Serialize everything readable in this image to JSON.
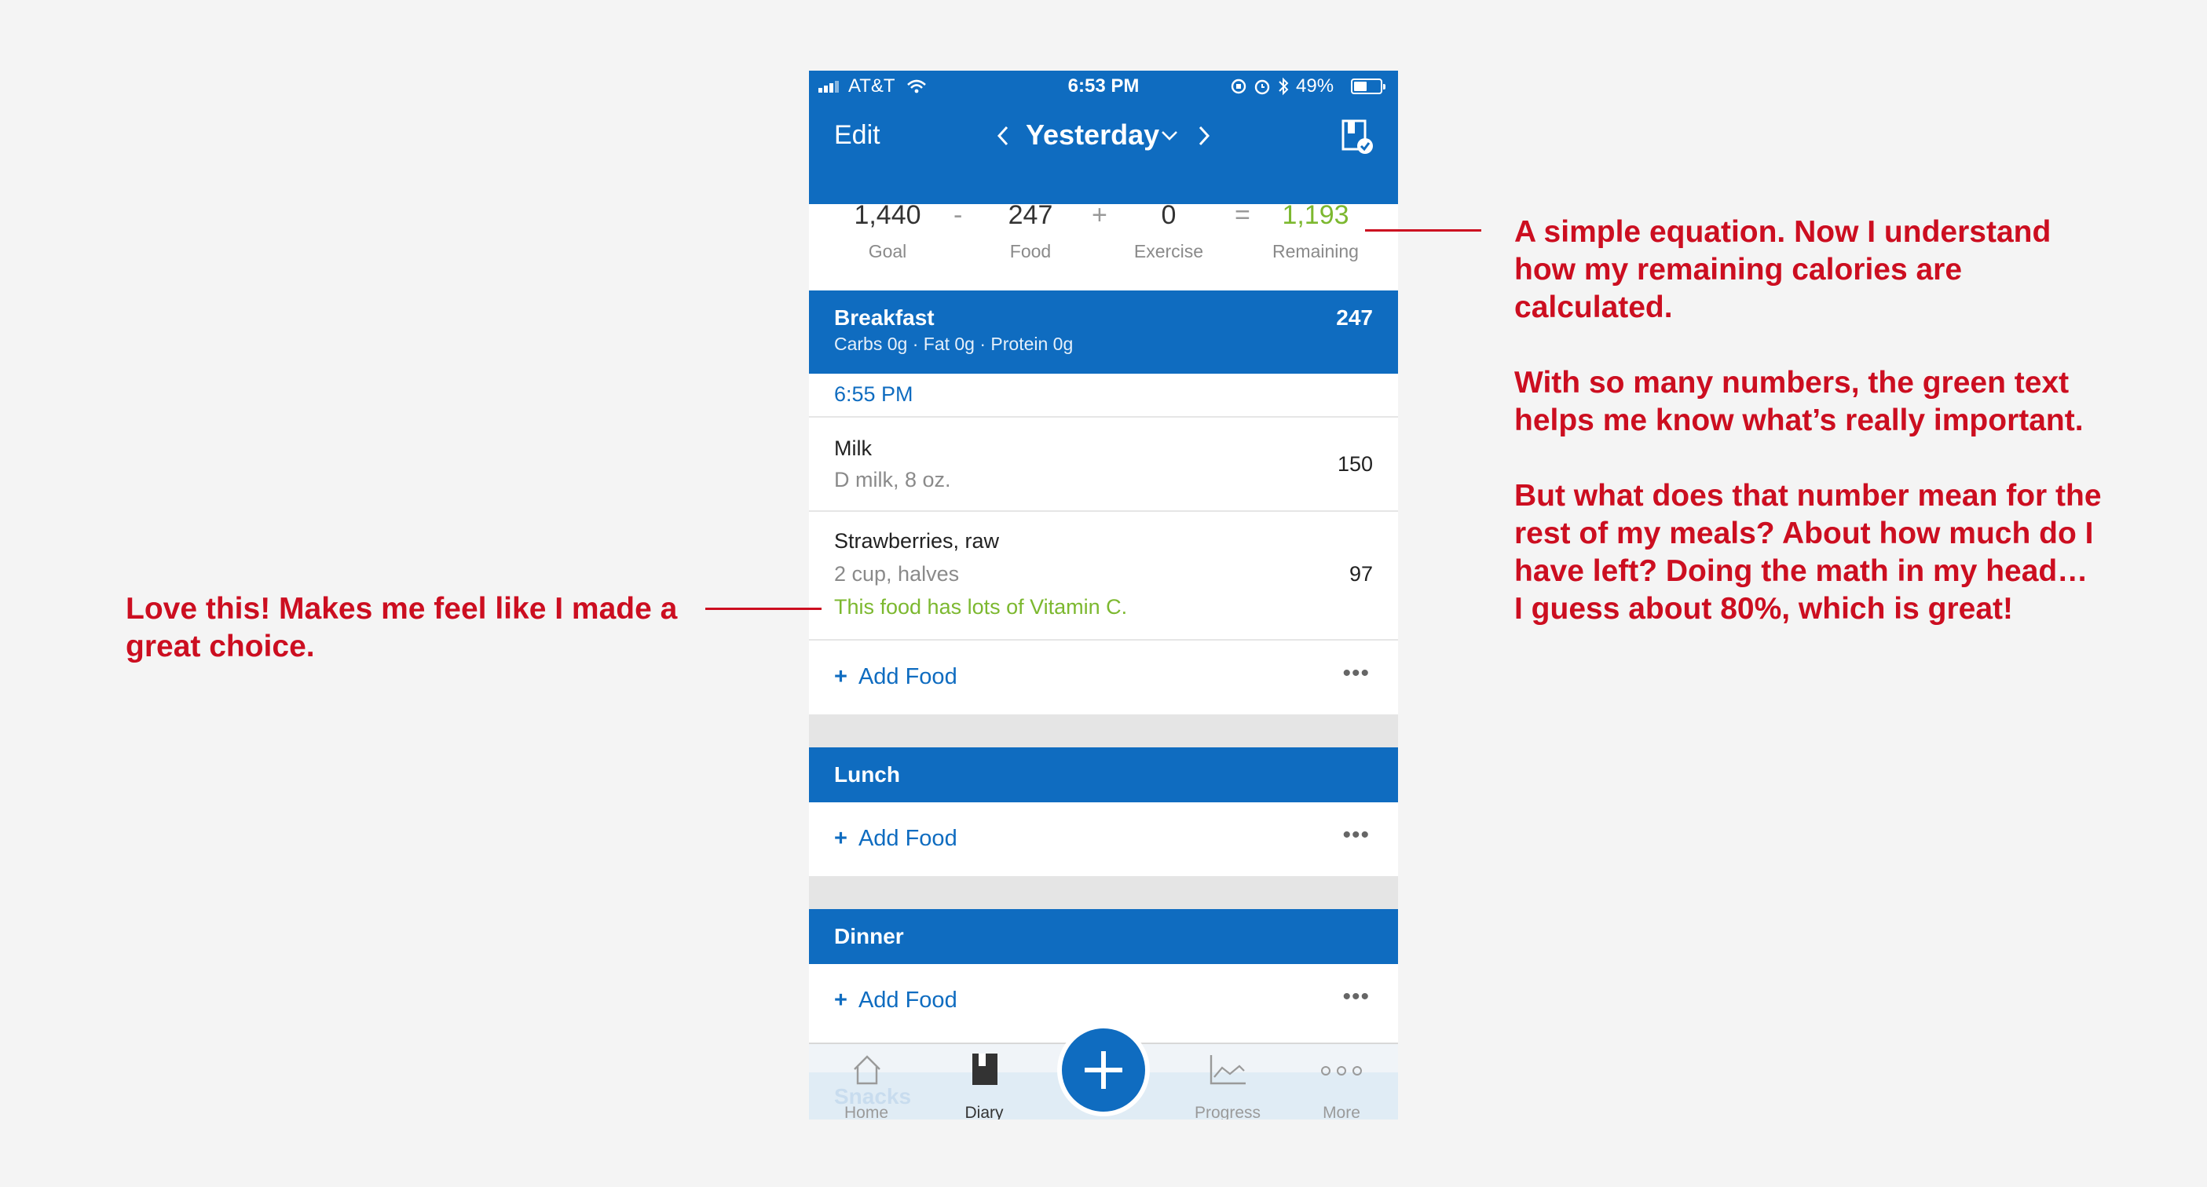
{
  "status_bar": {
    "carrier": "AT&T",
    "time": "6:53 PM",
    "battery": "49%",
    "battery_level": 0.49
  },
  "nav": {
    "edit_label": "Edit",
    "title": "Yesterday",
    "prev_icon": "chevron-left-icon",
    "next_icon": "chevron-right-icon",
    "dropdown_icon": "chevron-down-icon",
    "action_icon": "diary-check-icon"
  },
  "summary": {
    "goal_value": "1,440",
    "goal_label": "Goal",
    "op_minus": "-",
    "food_value": "247",
    "food_label": "Food",
    "op_plus": "+",
    "exercise_value": "0",
    "exercise_label": "Exercise",
    "op_equals": "=",
    "remaining_value": "1,193",
    "remaining_label": "Remaining",
    "remaining_color": "#7cb82f"
  },
  "breakfast": {
    "title": "Breakfast",
    "calories": "247",
    "macros": "Carbs 0g · Fat 0g · Protein 0g",
    "time": "6:55 PM",
    "items": [
      {
        "name": "Milk",
        "detail": "D milk, 8 oz.",
        "calories": "150"
      },
      {
        "name": "Strawberries, raw",
        "detail": "2 cup, halves",
        "note": "This food has lots of Vitamin C.",
        "calories": "97"
      }
    ],
    "add_label": "Add Food"
  },
  "lunch": {
    "title": "Lunch",
    "add_label": "Add Food"
  },
  "dinner": {
    "title": "Dinner",
    "add_label": "Add Food"
  },
  "snacks": {
    "title": "Snacks"
  },
  "tabs": [
    {
      "label": "Home",
      "icon": "home-icon"
    },
    {
      "label": "Diary",
      "icon": "diary-icon"
    },
    {
      "label": "Progress",
      "icon": "progress-chart-icon"
    },
    {
      "label": "More",
      "icon": "more-dots-icon"
    }
  ],
  "fab_icon": "plus-icon",
  "annotations": {
    "right_1_line1": "A simple equation. Now I understand",
    "right_1_line2": "how my remaining calories are",
    "right_1_line3": "calculated.",
    "right_2_line1": "With so many numbers, the green text",
    "right_2_line2": "helps me know what’s really important.",
    "right_3_line1": "But what does that number mean for the",
    "right_3_line2": "rest of my meals? About how much do I",
    "right_3_line3": "have left? Doing the math in my head…",
    "right_3_line4": "I guess about 80%, which is great!",
    "left_line1": "Love this! Makes me feel like I made a",
    "left_line2": "great choice.",
    "color": "#cc0e20"
  },
  "colors": {
    "brand_blue": "#0f6cc0",
    "accent_green": "#7cb82f"
  }
}
